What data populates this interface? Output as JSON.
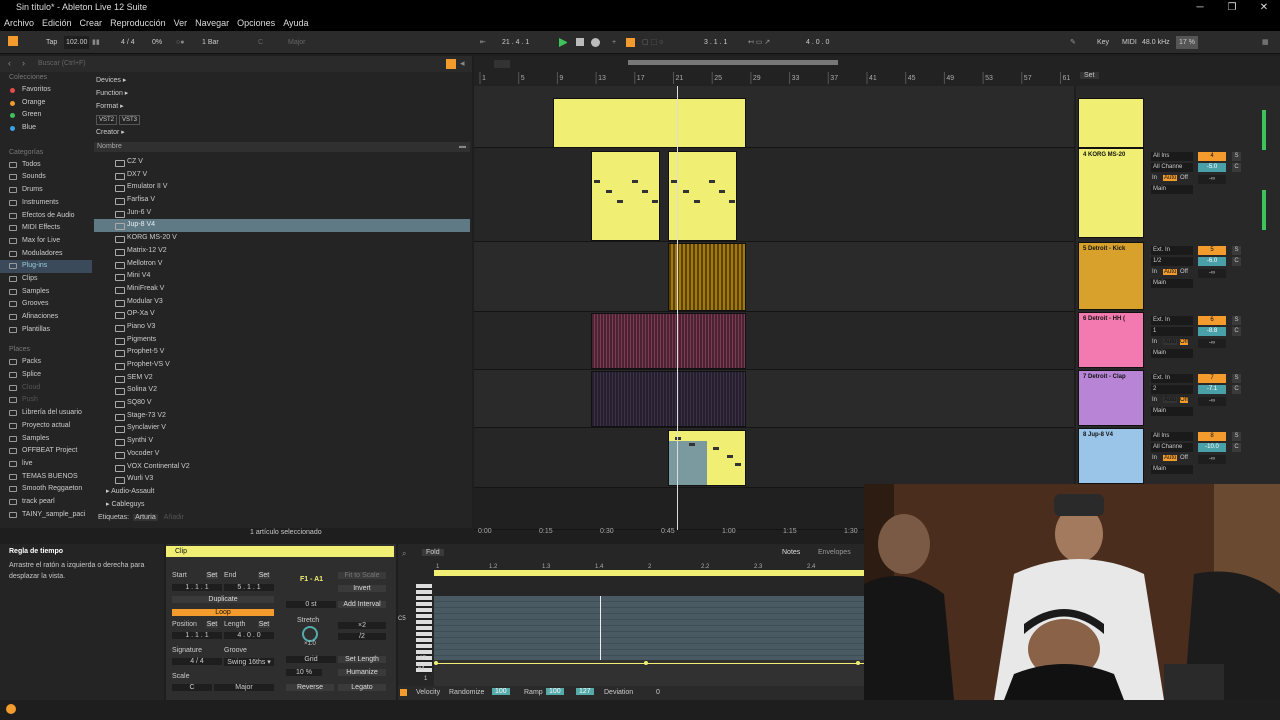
{
  "window": {
    "title": "Sin título* - Ableton Live 12 Suite",
    "min": "─",
    "restore": "❐",
    "close": "✕"
  },
  "menu": [
    "Archivo",
    "Edición",
    "Crear",
    "Reproducción",
    "Ver",
    "Navegar",
    "Opciones",
    "Ayuda"
  ],
  "control": {
    "tap": "Tap",
    "tempo": "102.00",
    "signature": "4 / 4",
    "swing": "0%",
    "quantize": "1 Bar",
    "key": "C",
    "scale": "Major",
    "position": "21 .  4 .  1",
    "loop_start": "3 .  1 .  1",
    "loop_length": "4 .  0 .  0",
    "key_label": "Key",
    "midi_label": "MIDI",
    "sample_rate": "48.0 kHz",
    "cpu": "17 %"
  },
  "browser": {
    "search_placeholder": "Buscar (Ctrl+F)",
    "sections": {
      "colecciones": "Colecciones",
      "categorias": "Categorías",
      "lugares": "Places"
    },
    "collections": [
      {
        "label": "Favoritos",
        "color": "#e84a4a"
      },
      {
        "label": "Orange",
        "color": "#f39b2d"
      },
      {
        "label": "Green",
        "color": "#3fc25a"
      },
      {
        "label": "Blue",
        "color": "#3aa2e8"
      }
    ],
    "categories": [
      "Todos",
      "Sounds",
      "Drums",
      "Instruments",
      "Efectos de Audio",
      "MIDI Effects",
      "Max for Live",
      "Moduladores",
      "Plug-ins",
      "Clips",
      "Samples",
      "Grooves",
      "Afinaciones",
      "Plantillas"
    ],
    "selected_category": "Plug-ins",
    "places": [
      "Packs",
      "Splice",
      "Cloud",
      "Push",
      "Librería del usuario",
      "Proyecto actual",
      "Samples",
      "OFFBEAT Project",
      "live",
      "TEMAS BUENOS",
      "Smooth Reggaeton",
      "track pearl",
      "TAINY_sample_paci"
    ],
    "filters": {
      "devices": "Devices ▸",
      "function": "Function ▸",
      "format": "Format ▸",
      "creator": "Creator ▸",
      "chips": [
        "VST2",
        "VST3"
      ]
    },
    "name_header": "Nombre",
    "plugins": [
      "CZ V",
      "DX7 V",
      "Emulator II V",
      "Farfisa V",
      "Jun-6 V",
      "Jup-8 V4",
      "KORG MS-20 V",
      "Matrix-12 V2",
      "Mellotron V",
      "Mini V4",
      "MiniFreak V",
      "Modular V3",
      "OP-Xa V",
      "Piano V3",
      "Pigments",
      "Prophet-5 V",
      "Prophet-VS V",
      "SEM V2",
      "Solina V2",
      "SQ80 V",
      "Stage-73 V2",
      "Synclavier V",
      "Synthi V",
      "Vocoder V",
      "VOX Continental V2",
      "Wurli V3"
    ],
    "selected_plugin": "Jup-8 V4",
    "folders": [
      "▸ Audio-Assault",
      "▸ Cableguys"
    ],
    "tags_label": "Etiquetas:",
    "tag": "Arturia",
    "add_tag": "Añadir",
    "status": "1 artículo seleccionado"
  },
  "arrangement": {
    "bar_numbers": [
      "1",
      "5",
      "9",
      "13",
      "17",
      "21",
      "25",
      "29",
      "33",
      "37",
      "41",
      "45",
      "49",
      "53",
      "57",
      "61"
    ],
    "set_label": "Set",
    "time_ruler": [
      "0:00",
      "0:15",
      "0:30",
      "0:45",
      "1:00",
      "1:15",
      "1:30"
    ]
  },
  "mixer": {
    "tracks": [
      {
        "name": "4 KORG MS-20",
        "color": "#f0ef74",
        "input": "All Ins",
        "channel": "All Channe",
        "number": "4",
        "vol": "-5.0",
        "pan": "C",
        "monitor": "Auto",
        "out": "Main",
        "send": "-∞"
      },
      {
        "name": "5 Detroit - Kick",
        "color": "#d7a12b",
        "input": "Ext. In",
        "channel": "1/2",
        "number": "5",
        "vol": "-6.0",
        "pan": "C",
        "monitor": "Auto",
        "out": "Main",
        "send": "-∞"
      },
      {
        "name": "6 Detroit - HH (",
        "color": "#f27ab0",
        "input": "Ext. In",
        "channel": "1",
        "number": "6",
        "vol": "-8.8",
        "pan": "C",
        "monitor": "Auto",
        "out": "Main",
        "send": "-∞"
      },
      {
        "name": "7 Detroit - Clap",
        "color": "#b884d6",
        "input": "Ext. In",
        "channel": "2",
        "number": "7",
        "vol": "-7.1",
        "pan": "C",
        "monitor": "Auto",
        "out": "Main",
        "send": "-∞"
      },
      {
        "name": "8 Jup-8 V4",
        "color": "#9bc5e8",
        "input": "All Ins",
        "channel": "All Channe",
        "number": "8",
        "vol": "-10.0",
        "pan": "C",
        "monitor": "Auto",
        "out": "Main",
        "send": "-∞"
      }
    ],
    "in_label": "In",
    "off_label": "Off",
    "s_label": "S"
  },
  "info": {
    "title": "Regla de tiempo",
    "text": "Arrastre el ratón a izquierda o derecha para desplazar la vista."
  },
  "clip": {
    "tab": "Clip",
    "fold": "Fold",
    "notes_tab": "Notes",
    "env_tab": "Envelopes",
    "start": "Start",
    "end": "End",
    "set": "Set",
    "start_val": "1 .  1 .  1",
    "end_val": "5 .  1 .  1",
    "duplicate": "Duplicate",
    "loop": "Loop",
    "position": "Position",
    "length": "Length",
    "pos_val": "1 .  1 .  1",
    "len_val": "4 .  0 .  0",
    "signature": "Signature",
    "groove": "Groove",
    "sig_val": "4  /  4",
    "swing": "Swing 16ths ▾",
    "scale": "Scale",
    "scale_key": "C",
    "scale_name": "Major",
    "range": "F1 - A1",
    "fit_scale": "Fit to Scale",
    "invert": "Invert",
    "transpose": "0 st",
    "add_interval": "Add Interval",
    "stretch": "Stretch",
    "x2": "×2",
    "div2": "/2",
    "stretch_val": "×1.0",
    "grid": "Grid",
    "set_length": "Set Length",
    "pct": "10 %",
    "humanize": "Humanize",
    "reverse": "Reverse",
    "legato": "Legato"
  },
  "notes": {
    "ruler": [
      "1",
      "1.2",
      "1.3",
      "1.4",
      "2",
      "2.2",
      "2.3",
      "2.4"
    ],
    "key_c": "C5",
    "vel_127": "127",
    "vel_64": "64",
    "vel_1": "1",
    "velocity": "Velocity",
    "randomize": "Randomize",
    "rand_val": "100",
    "ramp": "Ramp",
    "ramp_a": "100",
    "ramp_b": "127",
    "deviation": "Deviation",
    "dev_val": "0"
  }
}
